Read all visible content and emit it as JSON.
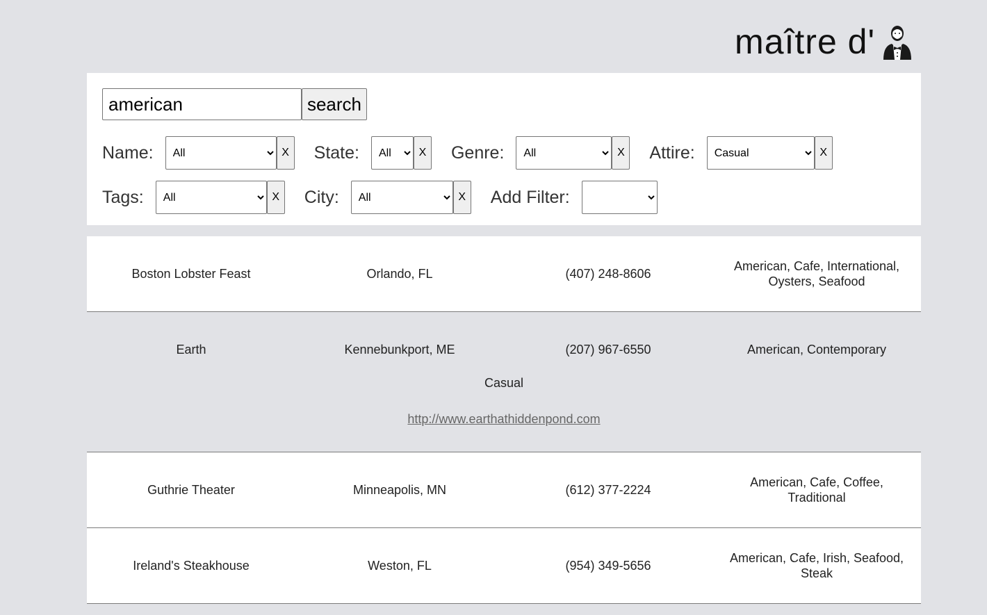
{
  "brand": {
    "name": "maître d'"
  },
  "search": {
    "value": "american",
    "button_label": "search"
  },
  "filters": {
    "name": {
      "label": "Name:",
      "selected": "All",
      "clear_label": "X"
    },
    "state": {
      "label": "State:",
      "selected": "All",
      "clear_label": "X"
    },
    "genre": {
      "label": "Genre:",
      "selected": "All",
      "clear_label": "X"
    },
    "attire": {
      "label": "Attire:",
      "selected": "Casual",
      "clear_label": "X"
    },
    "tags": {
      "label": "Tags:",
      "selected": "All",
      "clear_label": "X"
    },
    "city": {
      "label": "City:",
      "selected": "All",
      "clear_label": "X"
    },
    "add_filter": {
      "label": "Add Filter:",
      "selected": ""
    }
  },
  "results": [
    {
      "name": "Boston Lobster Feast",
      "location": "Orlando, FL",
      "phone": "(407) 248-8606",
      "genres": "American, Cafe, International, Oysters, Seafood"
    },
    {
      "name": "Earth",
      "location": "Kennebunkport, ME",
      "phone": "(207) 967-6550",
      "genres": "American, Contemporary",
      "attire": "Casual",
      "website": "http://www.earthathiddenpond.com"
    },
    {
      "name": "Guthrie Theater",
      "location": "Minneapolis, MN",
      "phone": "(612) 377-2224",
      "genres": "American, Cafe, Coffee, Traditional"
    },
    {
      "name": "Ireland's Steakhouse",
      "location": "Weston, FL",
      "phone": "(954) 349-5656",
      "genres": "American, Cafe, Irish, Seafood, Steak"
    }
  ],
  "colors": {
    "page_background": "#e1e2e6",
    "panel_background": "#ffffff",
    "link": "#666666"
  }
}
